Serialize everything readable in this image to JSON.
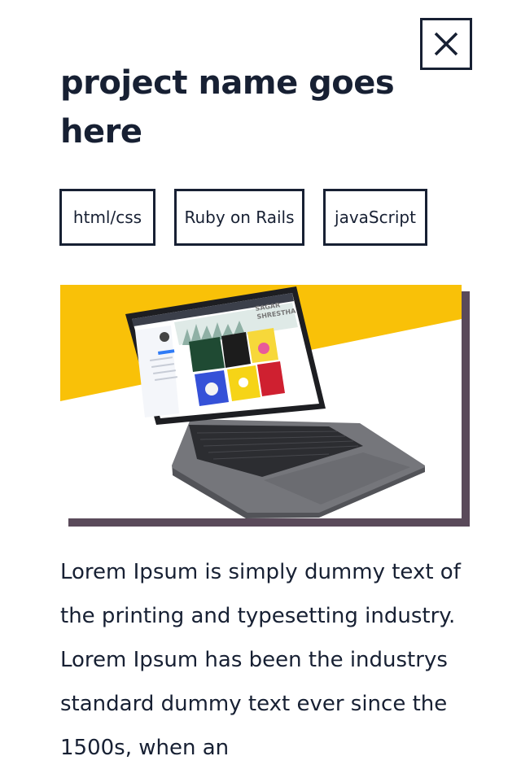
{
  "modal": {
    "close_icon": "close-icon",
    "title": "project name goes here",
    "tags": [
      "html/css",
      "Ruby on Rails",
      "javaScript"
    ],
    "screenshot_text": {
      "name_line1": "SAGAR",
      "name_line2": "SHRESTHA"
    },
    "description": "Lorem Ipsum is simply dummy text of the printing and typesetting industry. Lorem Ipsum has been the industrys standard dummy text ever since the 1500s, when an",
    "colors": {
      "text": "#172033",
      "accent_yellow": "#f9c108",
      "shadow": "#5a4a5a"
    }
  }
}
